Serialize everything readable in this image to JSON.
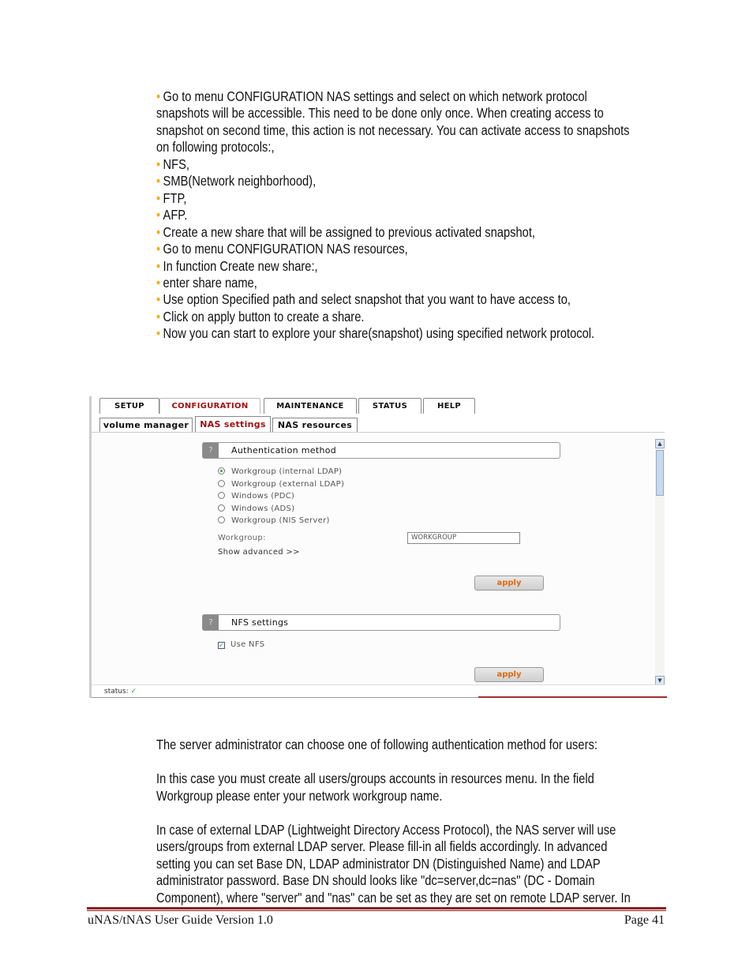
{
  "intro_lines": [
    {
      "bullet": true,
      "text": "Go to menu CONFIGURATION     NAS settings and select on which network protocol"
    },
    {
      "bullet": false,
      "text": "snapshots will be accessible. This need to be done only once. When creating access to"
    },
    {
      "bullet": false,
      "text": "snapshot on second time, this action is not necessary. You can activate access to snapshots"
    },
    {
      "bullet": false,
      "text": "on following protocols:,"
    },
    {
      "bullet": true,
      "text": "NFS,"
    },
    {
      "bullet": true,
      "text": "SMB(Network neighborhood),"
    },
    {
      "bullet": true,
      "text": "FTP,"
    },
    {
      "bullet": true,
      "text": "AFP."
    },
    {
      "bullet": true,
      "text": "Create a new share that will be assigned to previous activated snapshot,"
    },
    {
      "bullet": true,
      "text": "Go to menu CONFIGURATION     NAS resources,"
    },
    {
      "bullet": true,
      "text": "In function Create new share:,"
    },
    {
      "bullet": true,
      "text": "enter share name,"
    },
    {
      "bullet": true,
      "text": "Use option Specified path and select snapshot that you want to have access to,"
    },
    {
      "bullet": true,
      "text": "Click on apply button to create a share."
    },
    {
      "bullet": true,
      "text": "Now you can start to explore your share(snapshot) using specified network protocol."
    }
  ],
  "screenshot": {
    "tabs": [
      "SETUP",
      "CONFIGURATION",
      "MAINTENANCE",
      "STATUS",
      "HELP"
    ],
    "active_tab": "CONFIGURATION",
    "subtabs": [
      "volume manager",
      "NAS settings",
      "NAS resources"
    ],
    "active_subtab": "NAS settings",
    "auth": {
      "help": "?",
      "title": "Authentication method",
      "options": [
        "Workgroup (internal LDAP)",
        "Workgroup (external LDAP)",
        "Windows (PDC)",
        "Windows (ADS)",
        "Workgroup (NIS Server)"
      ],
      "selected": "Workgroup (internal LDAP)",
      "workgroup_label": "Workgroup:",
      "workgroup_value": "WORKGROUP",
      "show_advanced": "Show advanced >>",
      "apply": "apply"
    },
    "nfs": {
      "help": "?",
      "title": "NFS settings",
      "use_nfs_label": "Use NFS",
      "use_nfs_checked": true,
      "apply": "apply"
    },
    "status_label": "status:",
    "status_icon": "check-icon",
    "accent": "#a01010",
    "apply_color": "#e06a10"
  },
  "body_lines": [
    "The server administrator can choose one of following authentication method for users:",
    "",
    "In this case you must create all users/groups accounts in resources menu. In the field",
    "Workgroup please enter your network workgroup name.",
    "",
    "In case of external LDAP (Lightweight Directory Access Protocol), the NAS server will use",
    "users/groups from external LDAP server. Please fill-in all fields accordingly. In advanced",
    "setting you can set Base DN, LDAP administrator DN (Distinguished Name) and LDAP",
    "administrator password. Base DN should looks like \"dc=server,dc=nas\" (DC - Domain",
    "Component), where \"server\" and \"nas\" can be set as they are set on remote LDAP server. In"
  ],
  "footer": {
    "left": "uNAS/tNAS User Guide Version 1.0",
    "right": "Page 41",
    "rule_color": "#8b1a1a"
  }
}
